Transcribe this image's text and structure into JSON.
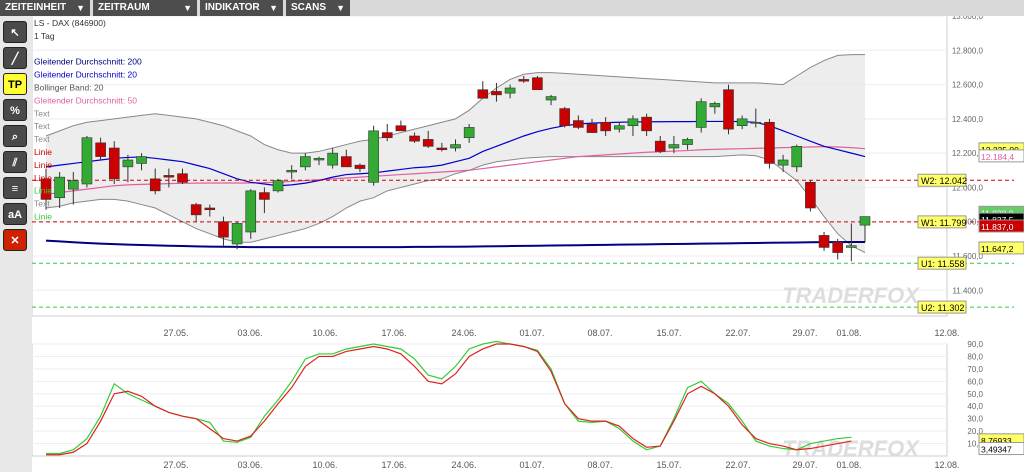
{
  "menu": [
    {
      "label": "ZEITEINHEIT",
      "arrow": "▼"
    },
    {
      "label": "ZEITRAUM",
      "arrow": "▼"
    },
    {
      "label": "INDIKATOR",
      "arrow": "▼"
    },
    {
      "label": "SCANS",
      "arrow": "▼"
    }
  ],
  "tools": [
    {
      "name": "cursor-tool-icon",
      "glyph": "↖",
      "style": "dark"
    },
    {
      "name": "line-tool-icon",
      "glyph": "╱",
      "style": "dark"
    },
    {
      "name": "tp-tool-button",
      "glyph": "TP",
      "style": "yellow"
    },
    {
      "name": "percent-tool-icon",
      "glyph": "%",
      "style": "dark"
    },
    {
      "name": "zoom-tool-icon",
      "glyph": "⌕",
      "style": "dark"
    },
    {
      "name": "channel-tool-icon",
      "glyph": "⫽",
      "style": "dark"
    },
    {
      "name": "fibonacci-tool-icon",
      "glyph": "≡",
      "style": "dark"
    },
    {
      "name": "text-tool-button",
      "glyph": "aA",
      "style": "dark"
    },
    {
      "name": "delete-tool-icon",
      "glyph": "✕",
      "style": "red"
    }
  ],
  "legend": [
    {
      "text": "LS - DAX (846900)",
      "color": "#333333"
    },
    {
      "text": "1 Tag",
      "color": "#333333"
    },
    {
      "text": "",
      "color": "#333333"
    },
    {
      "text": "Gleitender Durchschnitt: 200",
      "color": "#000080"
    },
    {
      "text": "Gleitender Durchschnitt: 20",
      "color": "#0000cc"
    },
    {
      "text": "Bollinger Band: 20",
      "color": "#555555"
    },
    {
      "text": "Gleitender Durchschnitt: 50",
      "color": "#e060a0"
    },
    {
      "text": "Text",
      "color": "#888888"
    },
    {
      "text": "Text",
      "color": "#888888"
    },
    {
      "text": "Text",
      "color": "#888888"
    },
    {
      "text": "Linie",
      "color": "#cc0000"
    },
    {
      "text": "Linie",
      "color": "#cc0000"
    },
    {
      "text": "Linie",
      "color": "#cc0000"
    },
    {
      "text": "Linie",
      "color": "#33cc33"
    },
    {
      "text": "Text",
      "color": "#888888"
    },
    {
      "text": "Linie",
      "color": "#33cc33"
    }
  ],
  "watermark": "TRADERFOX",
  "colors": {
    "up": "#33aa33",
    "down": "#cc0000",
    "ma200": "#000080",
    "ma20": "#0000cc",
    "ma50": "#e060a0",
    "bollinger": "#888888",
    "bollinger_fill": "#e8e8e8",
    "stoch_k": "#33cc33",
    "stoch_d": "#dd2222"
  },
  "chart_data": [
    {
      "type": "candlestick",
      "title": "LS - DAX (846900)",
      "x_tick_labels": [
        "27.05.",
        "03.06.",
        "10.06.",
        "17.06.",
        "24.06.",
        "01.07.",
        "08.07.",
        "15.07.",
        "22.07.",
        "29.07.",
        "01.08.",
        "12.08."
      ],
      "ylim": [
        11250,
        13000
      ],
      "y_ticks": [
        "13.000,0",
        "12.800,0",
        "12.600,0",
        "12.400,0",
        "12.200,0",
        "12.000,0",
        "11.800,0",
        "11.600,0",
        "11.400,0"
      ],
      "candles": [
        {
          "o": 12050,
          "h": 12110,
          "l": 11870,
          "c": 11930
        },
        {
          "o": 11940,
          "h": 12090,
          "l": 11880,
          "c": 12060
        },
        {
          "o": 11990,
          "h": 12090,
          "l": 11900,
          "c": 12040
        },
        {
          "o": 12020,
          "h": 12300,
          "l": 12000,
          "c": 12290
        },
        {
          "o": 12260,
          "h": 12290,
          "l": 12160,
          "c": 12180
        },
        {
          "o": 12230,
          "h": 12270,
          "l": 12020,
          "c": 12050
        },
        {
          "o": 12120,
          "h": 12190,
          "l": 12030,
          "c": 12160
        },
        {
          "o": 12140,
          "h": 12200,
          "l": 12100,
          "c": 12180
        },
        {
          "o": 12050,
          "h": 12110,
          "l": 11960,
          "c": 11980
        },
        {
          "o": 12070,
          "h": 12110,
          "l": 12000,
          "c": 12060
        },
        {
          "o": 12080,
          "h": 12110,
          "l": 12020,
          "c": 12030
        },
        {
          "o": 11900,
          "h": 11910,
          "l": 11800,
          "c": 11840
        },
        {
          "o": 11880,
          "h": 11900,
          "l": 11830,
          "c": 11870
        },
        {
          "o": 11800,
          "h": 11830,
          "l": 11660,
          "c": 11710
        },
        {
          "o": 11670,
          "h": 11800,
          "l": 11640,
          "c": 11790
        },
        {
          "o": 11740,
          "h": 11990,
          "l": 11700,
          "c": 11980
        },
        {
          "o": 11970,
          "h": 12000,
          "l": 11850,
          "c": 11930
        },
        {
          "o": 11980,
          "h": 12050,
          "l": 11970,
          "c": 12040
        },
        {
          "o": 12090,
          "h": 12130,
          "l": 12050,
          "c": 12100
        },
        {
          "o": 12120,
          "h": 12200,
          "l": 12100,
          "c": 12180
        },
        {
          "o": 12160,
          "h": 12180,
          "l": 12130,
          "c": 12170
        },
        {
          "o": 12130,
          "h": 12230,
          "l": 12110,
          "c": 12200
        },
        {
          "o": 12180,
          "h": 12220,
          "l": 12130,
          "c": 12120
        },
        {
          "o": 12130,
          "h": 12140,
          "l": 12090,
          "c": 12110
        },
        {
          "o": 12030,
          "h": 12360,
          "l": 12010,
          "c": 12330
        },
        {
          "o": 12320,
          "h": 12370,
          "l": 12270,
          "c": 12290
        },
        {
          "o": 12360,
          "h": 12390,
          "l": 12330,
          "c": 12330
        },
        {
          "o": 12300,
          "h": 12320,
          "l": 12260,
          "c": 12270
        },
        {
          "o": 12280,
          "h": 12330,
          "l": 12230,
          "c": 12240
        },
        {
          "o": 12230,
          "h": 12260,
          "l": 12210,
          "c": 12220
        },
        {
          "o": 12230,
          "h": 12280,
          "l": 12210,
          "c": 12250
        },
        {
          "o": 12290,
          "h": 12370,
          "l": 12260,
          "c": 12350
        },
        {
          "o": 12570,
          "h": 12620,
          "l": 12520,
          "c": 12520
        },
        {
          "o": 12560,
          "h": 12610,
          "l": 12500,
          "c": 12540
        },
        {
          "o": 12550,
          "h": 12600,
          "l": 12520,
          "c": 12580
        },
        {
          "o": 12630,
          "h": 12650,
          "l": 12610,
          "c": 12620
        },
        {
          "o": 12640,
          "h": 12650,
          "l": 12580,
          "c": 12570
        },
        {
          "o": 12510,
          "h": 12540,
          "l": 12480,
          "c": 12530
        },
        {
          "o": 12460,
          "h": 12470,
          "l": 12350,
          "c": 12360
        },
        {
          "o": 12390,
          "h": 12420,
          "l": 12340,
          "c": 12350
        },
        {
          "o": 12370,
          "h": 12400,
          "l": 12320,
          "c": 12320
        },
        {
          "o": 12380,
          "h": 12410,
          "l": 12300,
          "c": 12330
        },
        {
          "o": 12340,
          "h": 12380,
          "l": 12320,
          "c": 12360
        },
        {
          "o": 12360,
          "h": 12420,
          "l": 12300,
          "c": 12400
        },
        {
          "o": 12410,
          "h": 12430,
          "l": 12300,
          "c": 12330
        },
        {
          "o": 12270,
          "h": 12300,
          "l": 12200,
          "c": 12210
        },
        {
          "o": 12230,
          "h": 12300,
          "l": 12200,
          "c": 12250
        },
        {
          "o": 12250,
          "h": 12290,
          "l": 12220,
          "c": 12280
        },
        {
          "o": 12350,
          "h": 12520,
          "l": 12320,
          "c": 12500
        },
        {
          "o": 12470,
          "h": 12500,
          "l": 12430,
          "c": 12490
        },
        {
          "o": 12570,
          "h": 12600,
          "l": 12310,
          "c": 12340
        },
        {
          "o": 12360,
          "h": 12420,
          "l": 12340,
          "c": 12400
        },
        {
          "o": 12380,
          "h": 12460,
          "l": 12350,
          "c": 12380
        },
        {
          "o": 12380,
          "h": 12400,
          "l": 12110,
          "c": 12140
        },
        {
          "o": 12130,
          "h": 12190,
          "l": 12090,
          "c": 12160
        },
        {
          "o": 12120,
          "h": 12250,
          "l": 12090,
          "c": 12240
        },
        {
          "o": 12030,
          "h": 12040,
          "l": 11860,
          "c": 11880
        },
        {
          "o": 11720,
          "h": 11740,
          "l": 11630,
          "c": 11650
        },
        {
          "o": 11680,
          "h": 11700,
          "l": 11580,
          "c": 11620
        },
        {
          "o": 11650,
          "h": 11790,
          "l": 11570,
          "c": 11660
        },
        {
          "o": 11780,
          "h": 11820,
          "l": 11680,
          "c": 11830
        }
      ],
      "ma200": [
        11690,
        11685,
        11680,
        11676,
        11672,
        11669,
        11666,
        11664,
        11662,
        11660,
        11658,
        11656,
        11655,
        11654,
        11653,
        11652,
        11652,
        11652,
        11652,
        11652,
        11652,
        11652,
        11652,
        11652,
        11652,
        11652,
        11652,
        11653,
        11653,
        11654,
        11654,
        11655,
        11656,
        11657,
        11658,
        11659,
        11660,
        11661,
        11662,
        11663,
        11664,
        11665,
        11666,
        11667,
        11668,
        11669,
        11670,
        11671,
        11672,
        11673,
        11674,
        11675,
        11676,
        11677,
        11678,
        11679,
        11680,
        11681,
        11681,
        11682,
        11682
      ],
      "ma20": [
        12120,
        12130,
        12140,
        12150,
        12160,
        12170,
        12175,
        12178,
        12170,
        12160,
        12150,
        12130,
        12110,
        12080,
        12050,
        12030,
        12020,
        12010,
        12015,
        12025,
        12040,
        12060,
        12075,
        12080,
        12085,
        12095,
        12105,
        12115,
        12120,
        12130,
        12150,
        12170,
        12210,
        12240,
        12270,
        12300,
        12325,
        12345,
        12360,
        12370,
        12375,
        12378,
        12380,
        12382,
        12383,
        12383,
        12384,
        12384,
        12385,
        12385,
        12385,
        12384,
        12380,
        12360,
        12330,
        12300,
        12270,
        12240,
        12220,
        12200,
        12180
      ],
      "ma50": [
        11960,
        11970,
        11980,
        11990,
        12000,
        12010,
        12015,
        12018,
        12020,
        12022,
        12024,
        12025,
        12026,
        12026,
        12026,
        12026,
        12028,
        12030,
        12035,
        12040,
        12045,
        12050,
        12055,
        12060,
        12065,
        12070,
        12075,
        12080,
        12085,
        12090,
        12095,
        12100,
        12110,
        12120,
        12130,
        12140,
        12150,
        12160,
        12170,
        12180,
        12185,
        12190,
        12195,
        12200,
        12205,
        12208,
        12212,
        12215,
        12220,
        12222,
        12224,
        12226,
        12228,
        12230,
        12232,
        12234,
        12236,
        12238,
        12236,
        12232,
        12226
      ],
      "bollinger_upper": [
        12300,
        12330,
        12360,
        12380,
        12390,
        12400,
        12410,
        12420,
        12430,
        12420,
        12410,
        12400,
        12380,
        12360,
        12330,
        12300,
        12250,
        12220,
        12200,
        12200,
        12210,
        12230,
        12250,
        12270,
        12280,
        12300,
        12320,
        12340,
        12360,
        12380,
        12400,
        12450,
        12520,
        12580,
        12630,
        12660,
        12670,
        12670,
        12665,
        12660,
        12655,
        12650,
        12645,
        12640,
        12635,
        12630,
        12625,
        12620,
        12615,
        12610,
        12610,
        12610,
        12610,
        12605,
        12600,
        12650,
        12700,
        12740,
        12770,
        12775,
        12775
      ],
      "bollinger_lower": [
        11880,
        11890,
        11910,
        11920,
        11930,
        11930,
        11920,
        11900,
        11880,
        11840,
        11800,
        11760,
        11730,
        11700,
        11680,
        11680,
        11700,
        11720,
        11740,
        11760,
        11790,
        11830,
        11880,
        11920,
        11940,
        11980,
        12000,
        12020,
        12040,
        12050,
        12080,
        12100,
        12130,
        12150,
        12160,
        12170,
        12175,
        12180,
        12180,
        12180,
        12180,
        12180,
        12180,
        12180,
        12180,
        12180,
        12180,
        12180,
        12180,
        12180,
        12185,
        12190,
        12185,
        12160,
        12100,
        12040,
        11940,
        11830,
        11730,
        11660,
        11620
      ],
      "horizontal_lines": [
        {
          "value": 12042,
          "color": "#cc0000",
          "label": "W2: 12.042"
        },
        {
          "value": 11799,
          "color": "#cc0000",
          "label": "W1: 11.799"
        },
        {
          "value": 11558,
          "color": "#33cc33",
          "label": "U1: 11.558"
        },
        {
          "value": 11302,
          "color": "#33cc33",
          "label": "U2: 11.302"
        }
      ],
      "right_labels": [
        {
          "text": "12.225,00",
          "value": 12225,
          "bg": "#ffff66",
          "fg": "#000000"
        },
        {
          "text": "12.184,4",
          "value": 12184,
          "bg": "#ffffff",
          "fg": "#e060a0"
        },
        {
          "text": "11.838,0",
          "value": 11855,
          "bg": "#66cc66",
          "fg": "#ffffff"
        },
        {
          "text": "11.837,5",
          "value": 11815,
          "bg": "#000000",
          "fg": "#ffffff"
        },
        {
          "text": "11.837,0",
          "value": 11775,
          "bg": "#cc0000",
          "fg": "#ffffff"
        },
        {
          "text": "11.647,2",
          "value": 11647,
          "bg": "#ffff66",
          "fg": "#000000"
        }
      ]
    },
    {
      "type": "line",
      "ylim": [
        0,
        90
      ],
      "y_ticks": [
        "90,0",
        "80,0",
        "70,0",
        "60,0",
        "50,0",
        "40,0",
        "30,0",
        "20,0",
        "10,0"
      ],
      "x_tick_labels": [
        "27.05.",
        "03.06.",
        "10.06.",
        "17.06.",
        "24.06.",
        "01.07.",
        "08.07.",
        "15.07.",
        "22.07.",
        "29.07.",
        "01.08.",
        "12.08."
      ],
      "series": [
        {
          "values": [
            2,
            2,
            5,
            14,
            32,
            58,
            50,
            45,
            40,
            35,
            32,
            30,
            27,
            12,
            11,
            15,
            32,
            45,
            60,
            78,
            82,
            82,
            86,
            88,
            90,
            88,
            86,
            78,
            65,
            62,
            72,
            86,
            90,
            92,
            90,
            88,
            85,
            70,
            42,
            28,
            27,
            28,
            22,
            12,
            5,
            8,
            30,
            55,
            60,
            50,
            42,
            28,
            12,
            8,
            6,
            5,
            10,
            12,
            14,
            15
          ]
        },
        {
          "values": [
            1,
            1,
            3,
            10,
            28,
            50,
            52,
            48,
            40,
            35,
            32,
            30,
            22,
            14,
            12,
            16,
            28,
            42,
            55,
            72,
            80,
            80,
            84,
            86,
            88,
            86,
            82,
            72,
            60,
            58,
            66,
            80,
            86,
            90,
            90,
            88,
            84,
            68,
            42,
            30,
            28,
            28,
            24,
            14,
            7,
            8,
            28,
            50,
            56,
            50,
            40,
            25,
            14,
            10,
            8,
            5,
            6,
            8,
            10,
            12
          ]
        }
      ],
      "right_labels": [
        {
          "text": "8,76933",
          "value": 13,
          "bg": "#ffff66",
          "fg": "#000000"
        },
        {
          "text": "3,49347",
          "value": 6,
          "bg": "#ffffff",
          "fg": "#000000"
        }
      ]
    }
  ]
}
